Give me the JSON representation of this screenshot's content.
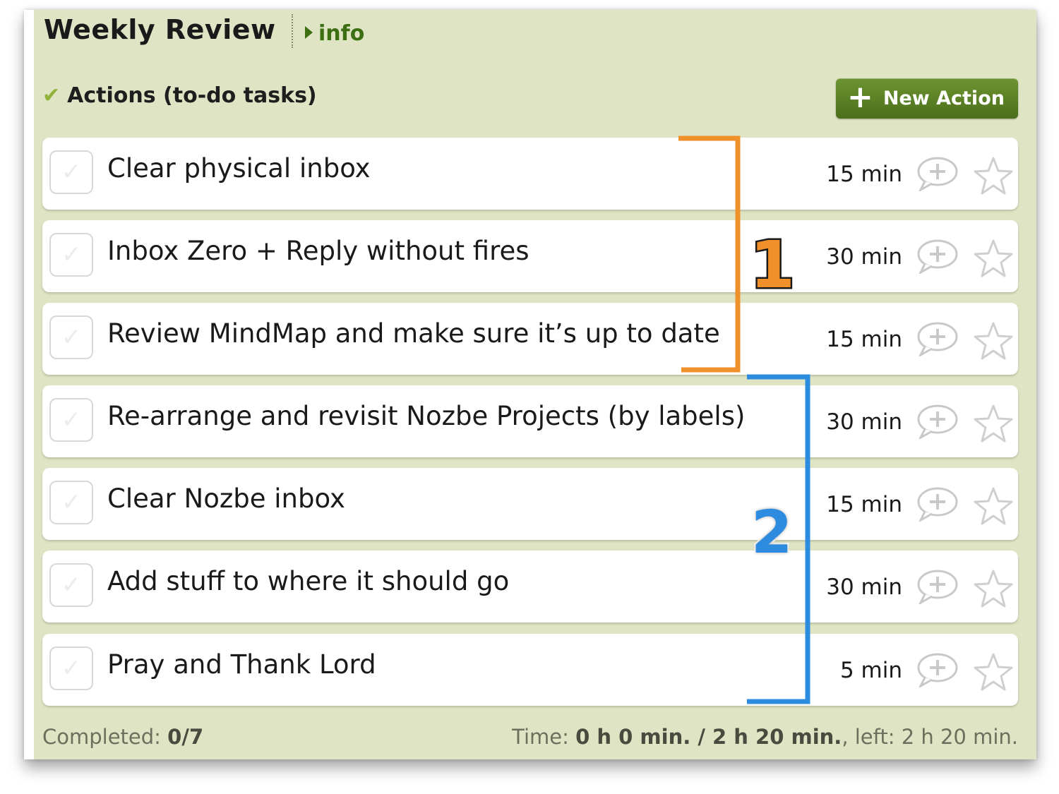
{
  "header": {
    "title": "Weekly Review",
    "info_link": "info"
  },
  "section": {
    "title": "Actions (to-do tasks)",
    "new_action_label": "New Action"
  },
  "tasks": [
    {
      "name": "Clear physical inbox",
      "time": "15 min"
    },
    {
      "name": "Inbox Zero + Reply without fires",
      "time": "30 min"
    },
    {
      "name": "Review MindMap and make sure it’s up to date",
      "time": "15 min"
    },
    {
      "name": "Re-arrange and revisit Nozbe Projects (by labels)",
      "time": "30 min"
    },
    {
      "name": "Clear Nozbe inbox",
      "time": "15 min"
    },
    {
      "name": "Add stuff to where it should go",
      "time": "30 min"
    },
    {
      "name": "Pray and Thank Lord",
      "time": "5 min"
    }
  ],
  "footer": {
    "completed_label": "Completed:",
    "completed_value": "0/7",
    "time_label": "Time:",
    "time_value": "0 h 0 min. / 2 h 20 min.",
    "left_text": ", left: 2 h 20 min."
  },
  "annotations": {
    "group1_label": "1",
    "group2_label": "2",
    "group1_color": "#f0902a",
    "group2_color": "#2e8ce0"
  },
  "colors": {
    "panel_bg": "#dfe5c4",
    "accent_green": "#3c6e12",
    "button_green": "#5a8225"
  },
  "icons": {
    "comment": "add-comment-icon",
    "star": "star-icon",
    "check": "checkmark-icon"
  }
}
